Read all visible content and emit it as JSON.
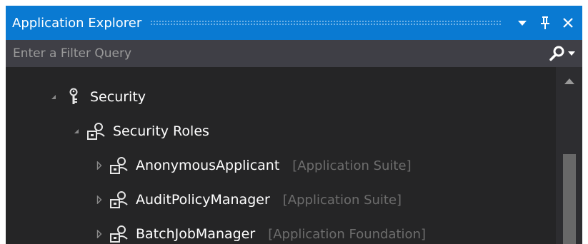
{
  "window": {
    "title": "Application Explorer",
    "accent_color": "#0a7ad2"
  },
  "title_buttons": {
    "dropdown_icon": "triangle-down-icon",
    "pin_icon": "pin-icon",
    "close_icon": "close-icon"
  },
  "filter": {
    "placeholder": "Enter a Filter Query",
    "value": "",
    "search_icon": "search-icon"
  },
  "tree": {
    "nodes": [
      {
        "label": "Security",
        "model": "",
        "expanded": true,
        "icon": "security-key-icon"
      },
      {
        "label": "Security Roles",
        "model": "",
        "expanded": true,
        "icon": "security-roles-icon"
      },
      {
        "label": "AnonymousApplicant",
        "model": "[Application Suite]",
        "expanded": false,
        "icon": "security-role-icon"
      },
      {
        "label": "AuditPolicyManager",
        "model": "[Application Suite]",
        "expanded": false,
        "icon": "security-role-icon"
      },
      {
        "label": "BatchJobManager",
        "model": "[Application Foundation]",
        "expanded": false,
        "icon": "security-role-icon"
      }
    ]
  }
}
